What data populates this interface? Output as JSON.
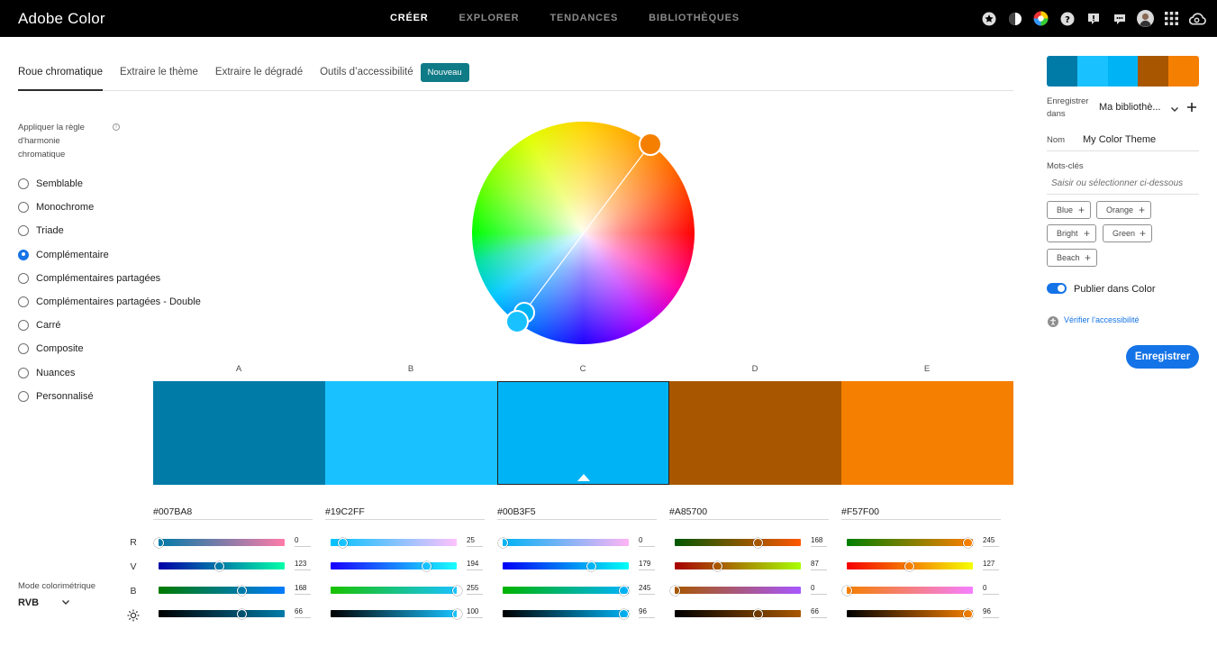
{
  "app": {
    "title": "Adobe Color"
  },
  "nav": [
    {
      "label": "CRÉER",
      "active": true
    },
    {
      "label": "EXPLORER",
      "active": false
    },
    {
      "label": "TENDANCES",
      "active": false
    },
    {
      "label": "BIBLIOTHÈQUES",
      "active": false
    }
  ],
  "top_icons": [
    "star-icon",
    "contrast-icon",
    "color-wheel-icon",
    "help-icon",
    "alert-icon",
    "chat-icon",
    "user-avatar",
    "apps-grid-icon",
    "creative-cloud-icon"
  ],
  "tabs": [
    {
      "label": "Roue chromatique",
      "active": true
    },
    {
      "label": "Extraire le thème",
      "active": false
    },
    {
      "label": "Extraire le dégradé",
      "active": false
    },
    {
      "label": "Outils d’accessibilité",
      "active": false
    }
  ],
  "new_badge": "Nouveau",
  "harmony": {
    "heading": "Appliquer la règle d'harmonie chromatique",
    "info_icon": "info-icon",
    "selected": "Complémentaire",
    "rules": [
      "Semblable",
      "Monochrome",
      "Triade",
      "Complémentaire",
      "Complémentaires partagées",
      "Complémentaires partagées - Double",
      "Carré",
      "Composite",
      "Nuances",
      "Personnalisé"
    ]
  },
  "colors": [
    {
      "letter": "A",
      "hex": "#007BA8",
      "r": 0,
      "g": 123,
      "b": 168,
      "brightness": 66
    },
    {
      "letter": "B",
      "hex": "#19C2FF",
      "r": 25,
      "g": 194,
      "b": 255,
      "brightness": 100
    },
    {
      "letter": "C",
      "hex": "#00B3F5",
      "r": 0,
      "g": 179,
      "b": 245,
      "brightness": 96,
      "selected": true
    },
    {
      "letter": "D",
      "hex": "#A85700",
      "r": 168,
      "g": 87,
      "b": 0,
      "brightness": 66
    },
    {
      "letter": "E",
      "hex": "#F57F00",
      "r": 245,
      "g": 127,
      "b": 0,
      "brightness": 96
    }
  ],
  "channels": [
    "R",
    "V",
    "B"
  ],
  "brightness_icon": "brightness-icon",
  "mode": {
    "label": "Mode colorimétrique",
    "value": "RVB"
  },
  "panel": {
    "save_in_label": "Enregistrer dans",
    "library": "Ma bibliothè...",
    "name_label": "Nom",
    "name_value": "My Color Theme",
    "keywords_label": "Mots-clés",
    "keywords_placeholder": "Saisir ou sélectionner ci-dessous",
    "tags": [
      "Blue",
      "Orange",
      "Bright",
      "Green",
      "Beach"
    ],
    "publish_label": "Publier dans Color",
    "publish_on": true,
    "accessibility_link": "Vérifier l’accessibilité",
    "save_button": "Enregistrer"
  }
}
